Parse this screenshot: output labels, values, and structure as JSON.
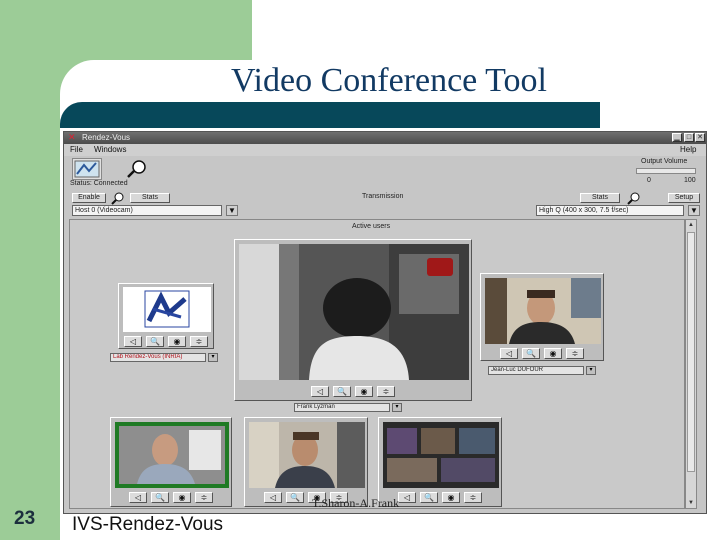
{
  "slide": {
    "title": "Video Conference Tool",
    "number": "23",
    "footer": "IVS-Rendez-Vous",
    "credit": "T.Sharon-A.Frank"
  },
  "app": {
    "window_title": "Rendez-Vous",
    "menu": [
      "File",
      "Windows",
      "Help"
    ],
    "toolbar": {
      "volume_label": "Output Volume",
      "volume_min": "0",
      "volume_max": "100",
      "status": "Status: Connected"
    },
    "row2": {
      "left_buttons": [
        "Enable",
        "Stats"
      ],
      "center_label": "Transmission",
      "right_buttons": [
        "Stats",
        "Setup"
      ],
      "left_field": "Host 0 (Videocam)",
      "right_field": "High Q (400 x 300, 7.5 f/sec)"
    },
    "section_label": "Active users",
    "users": [
      {
        "name": "Lab Rendez-Vous (INRIA)"
      },
      {
        "name": "Frank Lyzman"
      },
      {
        "name": "Jean-Luc DUFOUR"
      },
      {
        "name": ""
      },
      {
        "name": ""
      },
      {
        "name": ""
      }
    ],
    "controls": [
      "◁",
      "🔍",
      "◉",
      "≑"
    ]
  },
  "colors": {
    "slide_green": "#9ccc97",
    "title_bar": "#07485a",
    "title_text": "#123a63",
    "window_gray": "#c6c6c6"
  }
}
